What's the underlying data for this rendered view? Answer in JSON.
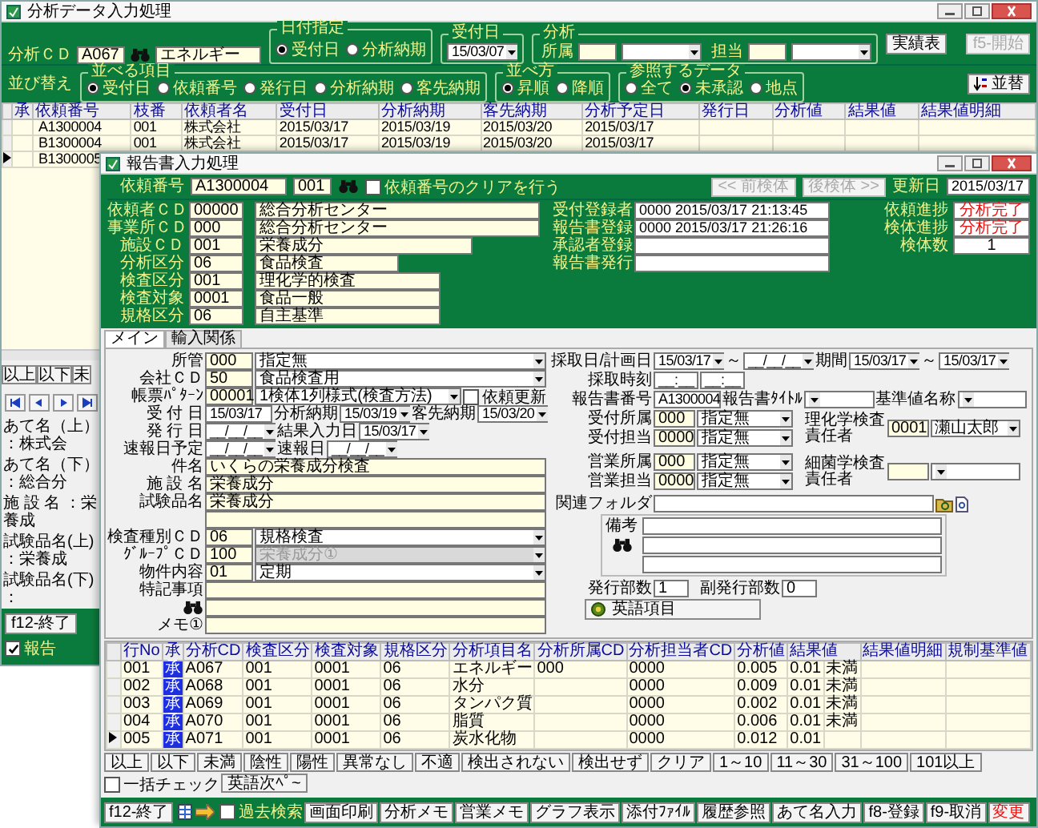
{
  "back_window": {
    "title": "分析データ入力処理",
    "analysis_cd": {
      "label": "分析ＣＤ",
      "code": "A067",
      "name": "エネルギー"
    },
    "date_spec": {
      "title": "日付指定",
      "options": [
        {
          "label": "受付日",
          "selected": true
        },
        {
          "label": "分析納期",
          "selected": false
        }
      ]
    },
    "receipt_date": {
      "title": "受付日",
      "value": "15/03/07"
    },
    "analysis": {
      "title": "分析",
      "fields": [
        {
          "label": "所属"
        },
        {
          "label": "担当"
        }
      ]
    },
    "buttons": [
      {
        "label": "実績表",
        "disabled": false
      },
      {
        "label": "f5-開始",
        "disabled": true
      }
    ],
    "sort": {
      "label": "並び替え",
      "groups": [
        {
          "title": "並べる項目",
          "options": [
            {
              "label": "受付日",
              "selected": true
            },
            {
              "label": "依頼番号",
              "selected": false
            },
            {
              "label": "発行日",
              "selected": false
            },
            {
              "label": "分析納期",
              "selected": false
            },
            {
              "label": "客先納期",
              "selected": false
            }
          ]
        },
        {
          "title": "並べ方",
          "options": [
            {
              "label": "昇順",
              "selected": true
            },
            {
              "label": "降順",
              "selected": false
            }
          ]
        },
        {
          "title": "参照するデータ",
          "options": [
            {
              "label": "全て",
              "selected": false
            },
            {
              "label": "未承認",
              "selected": true
            },
            {
              "label": "地点",
              "selected": false
            }
          ]
        }
      ],
      "button": "並替"
    },
    "table": {
      "columns": [
        "承",
        "依頼番号",
        "枝番",
        "依頼者名",
        "受付日",
        "分析納期",
        "客先納期",
        "分析予定日",
        "発行日",
        "分析値",
        "結果値",
        "結果値明細"
      ],
      "rows": [
        {
          "selected": false,
          "cells": [
            null,
            "A1300004",
            "001",
            "株式会社",
            "2015/03/17",
            "2015/03/19",
            "2015/03/20",
            "2015/03/17",
            null,
            null,
            null,
            null
          ]
        },
        {
          "selected": false,
          "cells": [
            null,
            "B1300004",
            "001",
            "株式会社",
            "2015/03/17",
            "2015/03/19",
            "2015/03/20",
            "2015/03/17",
            null,
            null,
            null,
            null
          ]
        },
        {
          "selected": true,
          "cells": [
            null,
            "B1300005",
            null,
            null,
            null,
            null,
            null,
            null,
            null,
            null,
            null,
            null
          ]
        }
      ]
    },
    "filter_buttons": [
      "以上",
      "以下",
      "未"
    ],
    "info": [
      "あて名（上）：株式会",
      "あて名（下）：総合分",
      "施 設 名 ：栄養成",
      "試験品名(上)：栄養成",
      "試験品名(下)："
    ],
    "footer": {
      "button": "f12-終了",
      "checkbox": {
        "label": "報告",
        "checked": true
      }
    }
  },
  "front_window": {
    "title": "報告書入力処理",
    "request": {
      "label": "依頼番号",
      "number": "A1300004",
      "branch": "001",
      "clear_checkbox": {
        "label": "依頼番号のクリアを行う",
        "checked": false
      }
    },
    "nav_buttons": [
      {
        "label": "<< 前検体",
        "disabled": true
      },
      {
        "label": "後検体 >>",
        "disabled": true
      }
    ],
    "updated": {
      "label": "更新日",
      "value": "2015/03/17"
    },
    "requester_fields": [
      {
        "label": "依頼者ＣＤ",
        "code": "00000",
        "name": "総合分析センター"
      },
      {
        "label": "事業所ＣＤ",
        "code": "000",
        "name": "総合分析センター"
      },
      {
        "label": "施設ＣＤ",
        "code": "001",
        "name": "栄養成分"
      },
      {
        "label": "分析区分",
        "code": "06",
        "name": "食品検査"
      },
      {
        "label": "検査区分",
        "code": "001",
        "name": "理化学的検査"
      },
      {
        "label": "検査対象",
        "code": "0001",
        "name": "食品一般"
      },
      {
        "label": "規格区分",
        "code": "06",
        "name": "自主基準"
      }
    ],
    "registrations": [
      {
        "label": "受付登録者",
        "value": "0000  2015/03/17 21:13:45"
      },
      {
        "label": "報告書登録",
        "value": "0000  2015/03/17 21:26:16"
      },
      {
        "label": "承認者登録"
      },
      {
        "label": "報告書発行"
      }
    ],
    "progress": [
      {
        "label": "依頼進捗",
        "value": "分析完了",
        "kind": "status"
      },
      {
        "label": "検体進捗",
        "value": "分析完了",
        "kind": "status"
      },
      {
        "label": "検体数",
        "value": "1",
        "kind": "count"
      }
    ],
    "tabs": [
      {
        "label": "メイン",
        "selected": true
      },
      {
        "label": "輸入関係",
        "selected": false
      }
    ],
    "form": {
      "left": [
        [
          {
            "kind": "label",
            "text": "所管"
          },
          {
            "kind": "code",
            "value": "000"
          },
          {
            "kind": "select",
            "value": "指定無",
            "disabled": false
          }
        ],
        [
          {
            "kind": "label",
            "text": "会社ＣＤ"
          },
          {
            "kind": "code",
            "value": "50"
          },
          {
            "kind": "select",
            "value": "食品検査用",
            "disabled": false
          }
        ],
        [
          {
            "kind": "label",
            "text": "帳票ﾊﾟﾀｰﾝ"
          },
          {
            "kind": "code",
            "value": "00001"
          },
          {
            "kind": "select",
            "value": "1検体1列様式(検査方法)",
            "disabled": false
          },
          {
            "kind": "check",
            "label": "依頼更新",
            "checked": false
          }
        ],
        [
          {
            "kind": "label",
            "text": "受 付 日"
          },
          {
            "kind": "plain",
            "value": "15/03/17"
          },
          {
            "kind": "label",
            "text": "分析納期"
          },
          {
            "kind": "date",
            "value": "15/03/19"
          },
          {
            "kind": "label",
            "text": "客先納期"
          },
          {
            "kind": "date",
            "value": "15/03/20"
          }
        ],
        [
          {
            "kind": "label",
            "text": "発 行 日"
          },
          {
            "kind": "date",
            "value": "__/__/__"
          },
          {
            "kind": "label",
            "text": "結果入力日"
          },
          {
            "kind": "date",
            "value": "15/03/17"
          }
        ],
        [
          {
            "kind": "label",
            "text": "速報日予定"
          },
          {
            "kind": "date",
            "value": "__/__/__"
          },
          {
            "kind": "label",
            "text": "速報日"
          },
          {
            "kind": "date",
            "value": "__/__/__"
          }
        ],
        [
          {
            "kind": "label",
            "text": "件名"
          },
          {
            "kind": "field",
            "value": "いくらの栄養成分検査"
          }
        ],
        [
          {
            "kind": "label",
            "text": "施 設 名"
          },
          {
            "kind": "field",
            "value": "栄養成分"
          }
        ],
        [
          {
            "kind": "label",
            "text": "試験品名"
          },
          {
            "kind": "field",
            "value": "栄養成分"
          }
        ],
        [
          {
            "kind": "field"
          }
        ],
        [
          {
            "kind": "label",
            "text": "検査種別ＣＤ"
          },
          {
            "kind": "code",
            "value": "06"
          },
          {
            "kind": "select",
            "value": "規格検査",
            "disabled": false
          }
        ],
        [
          {
            "kind": "label",
            "text": "ｸﾞﾙｰﾌﾟＣＤ"
          },
          {
            "kind": "code",
            "value": "100"
          },
          {
            "kind": "select",
            "value": "栄養成分①",
            "disabled": true
          }
        ],
        [
          {
            "kind": "label",
            "text": "物件内容"
          },
          {
            "kind": "code",
            "value": "01"
          },
          {
            "kind": "select",
            "value": "定期",
            "disabled": false
          }
        ],
        [
          {
            "kind": "label",
            "text": "特記事項"
          },
          {
            "kind": "field"
          }
        ],
        [
          {
            "kind": "search"
          },
          {
            "kind": "field"
          }
        ],
        [
          {
            "kind": "label",
            "text": "メモ①"
          },
          {
            "kind": "field"
          }
        ]
      ],
      "right": [
        [
          {
            "kind": "label",
            "text": "採取日/計画日"
          },
          {
            "kind": "date",
            "value": "15/03/17"
          },
          {
            "kind": "sep",
            "text": "～"
          },
          {
            "kind": "date",
            "value": "__/__/__"
          },
          {
            "kind": "label",
            "text": "期間"
          },
          {
            "kind": "date",
            "value": "15/03/17"
          },
          {
            "kind": "sep",
            "text": "～"
          },
          {
            "kind": "date",
            "value": "15/03/17"
          }
        ],
        [
          {
            "kind": "label",
            "text": "採取時刻"
          },
          {
            "kind": "time",
            "value": "__:__"
          },
          {
            "kind": "time",
            "value": "__:__"
          }
        ],
        [
          {
            "kind": "label",
            "text": "報告書番号"
          },
          {
            "kind": "plain",
            "value": "A1300004"
          },
          {
            "kind": "label",
            "text": "報告書ﾀｲﾄﾙ"
          },
          {
            "kind": "select",
            "disabled": false
          },
          {
            "kind": "label",
            "text": "基準値名称"
          },
          {
            "kind": "select",
            "disabled": false
          }
        ]
      ],
      "staff": [
        {
          "label": "受付所属",
          "code": "000",
          "value": "指定無"
        },
        {
          "label": "受付担当",
          "code": "0000",
          "value": "指定無"
        },
        {
          "label": "営業所属",
          "code": "000",
          "value": "指定無"
        },
        {
          "label": "営業担当",
          "code": "0000",
          "value": "指定無"
        }
      ],
      "managers": [
        {
          "label": "理化学検査責任者",
          "code": "0001",
          "value": "瀬山太郎"
        },
        {
          "label": "細菌学検査責任者"
        }
      ],
      "folder": {
        "label": "関連フォルダ"
      },
      "remarks": {
        "label": "備考"
      },
      "copies": [
        {
          "label": "発行部数",
          "value": "1"
        },
        {
          "label": "副発行部数",
          "value": "0"
        }
      ],
      "english_button": "英語項目"
    },
    "table": {
      "columns": [
        "行No",
        "承",
        "分析CD",
        "検査区分",
        "検査対象",
        "規格区分",
        "分析項目名",
        "分析所属CD",
        "分析担当者CD",
        "分析値",
        "結果値",
        "結果値明細",
        "規制基準値"
      ],
      "rows": [
        {
          "selected": false,
          "approved": true,
          "qualifier": "未満",
          "cells": [
            "001",
            "承",
            "A067",
            "001",
            "0001",
            "06",
            "エネルギー",
            "000",
            "0000",
            "0.005",
            "0.01",
            null,
            null
          ]
        },
        {
          "selected": false,
          "approved": true,
          "qualifier": "未満",
          "cells": [
            "002",
            "承",
            "A068",
            "001",
            "0001",
            "06",
            "水分",
            null,
            "0000",
            "0.009",
            "0.01",
            null,
            null
          ]
        },
        {
          "selected": false,
          "approved": true,
          "qualifier": "未満",
          "cells": [
            "003",
            "承",
            "A069",
            "001",
            "0001",
            "06",
            "タンパク質",
            null,
            "0000",
            "0.002",
            "0.01",
            null,
            null
          ]
        },
        {
          "selected": false,
          "approved": true,
          "qualifier": "未満",
          "cells": [
            "004",
            "承",
            "A070",
            "001",
            "0001",
            "06",
            "脂質",
            null,
            "0000",
            "0.006",
            "0.01",
            null,
            null
          ]
        },
        {
          "selected": true,
          "approved": true,
          "cells": [
            "005",
            "承",
            "A071",
            "001",
            "0001",
            "06",
            "炭水化物",
            null,
            "0000",
            "0.012",
            "0.01",
            null,
            null
          ]
        }
      ]
    },
    "filter_bar": [
      {
        "kind": "button",
        "label": "以上"
      },
      {
        "kind": "button",
        "label": "以下"
      },
      {
        "kind": "button",
        "label": "未満"
      },
      {
        "kind": "button",
        "label": "陰性"
      },
      {
        "kind": "button",
        "label": "陽性"
      },
      {
        "kind": "button",
        "label": "異常なし"
      },
      {
        "kind": "button",
        "label": "不適"
      },
      {
        "kind": "button",
        "label": "検出されない"
      },
      {
        "kind": "button",
        "label": "検出せず"
      },
      {
        "kind": "button",
        "label": "クリア"
      },
      {
        "kind": "button",
        "label": "1～10"
      },
      {
        "kind": "button",
        "label": "11～30"
      },
      {
        "kind": "button",
        "label": "31～100"
      },
      {
        "kind": "button",
        "label": "101以上"
      },
      {
        "kind": "check",
        "label": "一括チェック",
        "checked": false
      },
      {
        "kind": "button",
        "label": "英語次ﾍﾟ~"
      }
    ],
    "footer": [
      {
        "kind": "button",
        "label": "f12-終了"
      },
      {
        "kind": "icons"
      },
      {
        "kind": "check",
        "label": "過去検索",
        "checked": false
      },
      {
        "kind": "button",
        "label": "画面印刷"
      },
      {
        "kind": "button",
        "label": "分析メモ"
      },
      {
        "kind": "button",
        "label": "営業メモ"
      },
      {
        "kind": "button",
        "label": "グラフ表示"
      },
      {
        "kind": "button",
        "label": "添付ﾌｧｲﾙ"
      },
      {
        "kind": "button",
        "label": "履歴参照"
      },
      {
        "kind": "button",
        "label": "あて名入力"
      },
      {
        "kind": "button",
        "label": "f8-登録"
      },
      {
        "kind": "button",
        "label": "f9-取消"
      },
      {
        "kind": "danger",
        "label": "変更"
      }
    ]
  }
}
